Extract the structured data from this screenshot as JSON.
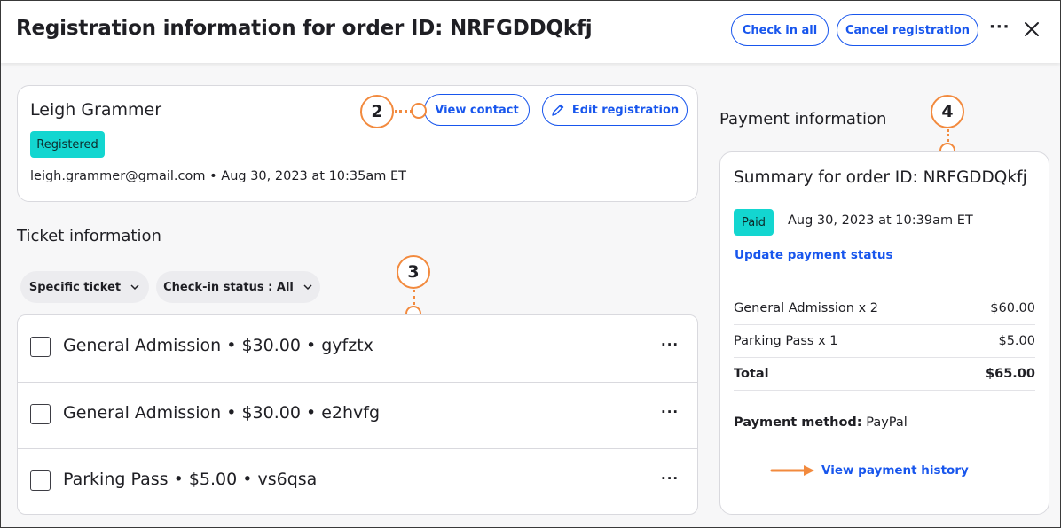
{
  "header": {
    "title": "Registration information for order ID: NRFGDDQkfj",
    "check_in_all": "Check in all",
    "cancel_registration": "Cancel registration",
    "more": "···"
  },
  "attendee": {
    "name": "Leigh Grammer",
    "status": "Registered",
    "meta": "leigh.grammer@gmail.com • Aug 30, 2023 at 10:35am ET",
    "view_contact": "View contact",
    "edit_registration": "Edit registration"
  },
  "tickets": {
    "section_title": "Ticket information",
    "filters": [
      {
        "label": "Specific ticket"
      },
      {
        "label": "Check-in status : All"
      }
    ],
    "rows": [
      {
        "label": "General Admission • $30.00 • gyfztx",
        "more": "···"
      },
      {
        "label": "General Admission • $30.00 • e2hvfg",
        "more": "···"
      },
      {
        "label": "Parking Pass • $5.00 • vs6qsa",
        "more": "···"
      }
    ]
  },
  "payment": {
    "section_title": "Payment information",
    "summary_title": "Summary for order ID: NRFGDDQkfj",
    "status": "Paid",
    "date": "Aug 30, 2023 at 10:39am ET",
    "update_link": "Update payment status",
    "line_items": [
      {
        "label": "General Admission x 2",
        "value": "$60.00"
      },
      {
        "label": "Parking Pass x 1",
        "value": "$5.00"
      }
    ],
    "total": {
      "label": "Total",
      "value": "$65.00"
    },
    "method_label": "Payment method:",
    "method_value": "PayPal",
    "history_link": "View payment history"
  },
  "callouts": [
    "2",
    "3",
    "4"
  ],
  "colors": {
    "accent": "#1856ed",
    "badge": "#13d6d0",
    "callout": "#f28a3e"
  }
}
